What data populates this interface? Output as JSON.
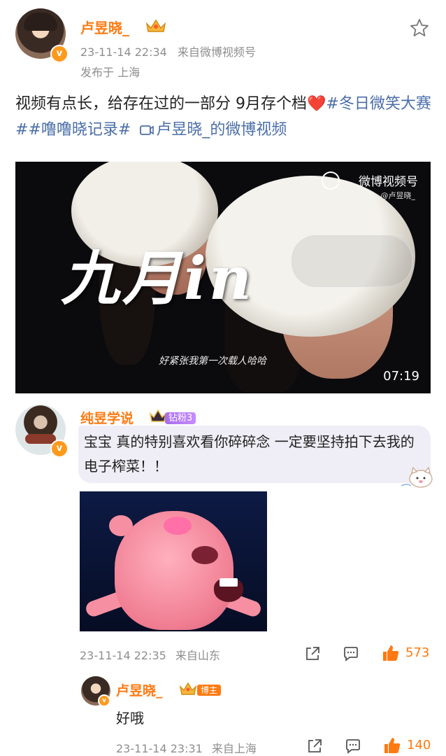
{
  "post": {
    "author": "卢昱晓_",
    "time": "23-11-14 22:34",
    "source": "来自微博视频号",
    "location": "发布于 上海",
    "text_plain": "视频有点长，给存在过的一部分 9月存个档",
    "text_heart": "❤️",
    "topic_1": "#冬日微笑大赛#",
    "topic_2": "#噜噜晓记录#",
    "video_link": "卢昱晓_的微博视频",
    "video_link_icon": "video-link-icon"
  },
  "video": {
    "title_text": "九月in",
    "subtitle": "好紧张我第一次载人哈哈",
    "duration": "07:19",
    "watermark_main": "微博视频号",
    "watermark_sub": "@卢昱晓_"
  },
  "comment": {
    "author": "纯昱学说",
    "fan_badge": "钻粉3",
    "text": "宝宝 真的特别喜欢看你碎碎念 一定要坚持拍下去我的电子榨菜！！",
    "time": "23-11-14 22:35",
    "source": "来自山东",
    "likes": "573"
  },
  "reply": {
    "author": "卢昱晓_",
    "badge": "博主",
    "text": "好哦",
    "time": "23-11-14 23:31",
    "source": "来自上海",
    "likes": "140"
  },
  "colors": {
    "username": "#ff7a12",
    "topic": "#4a6ea8",
    "meta": "#8e8e8e",
    "bubble": "#efedf5"
  }
}
